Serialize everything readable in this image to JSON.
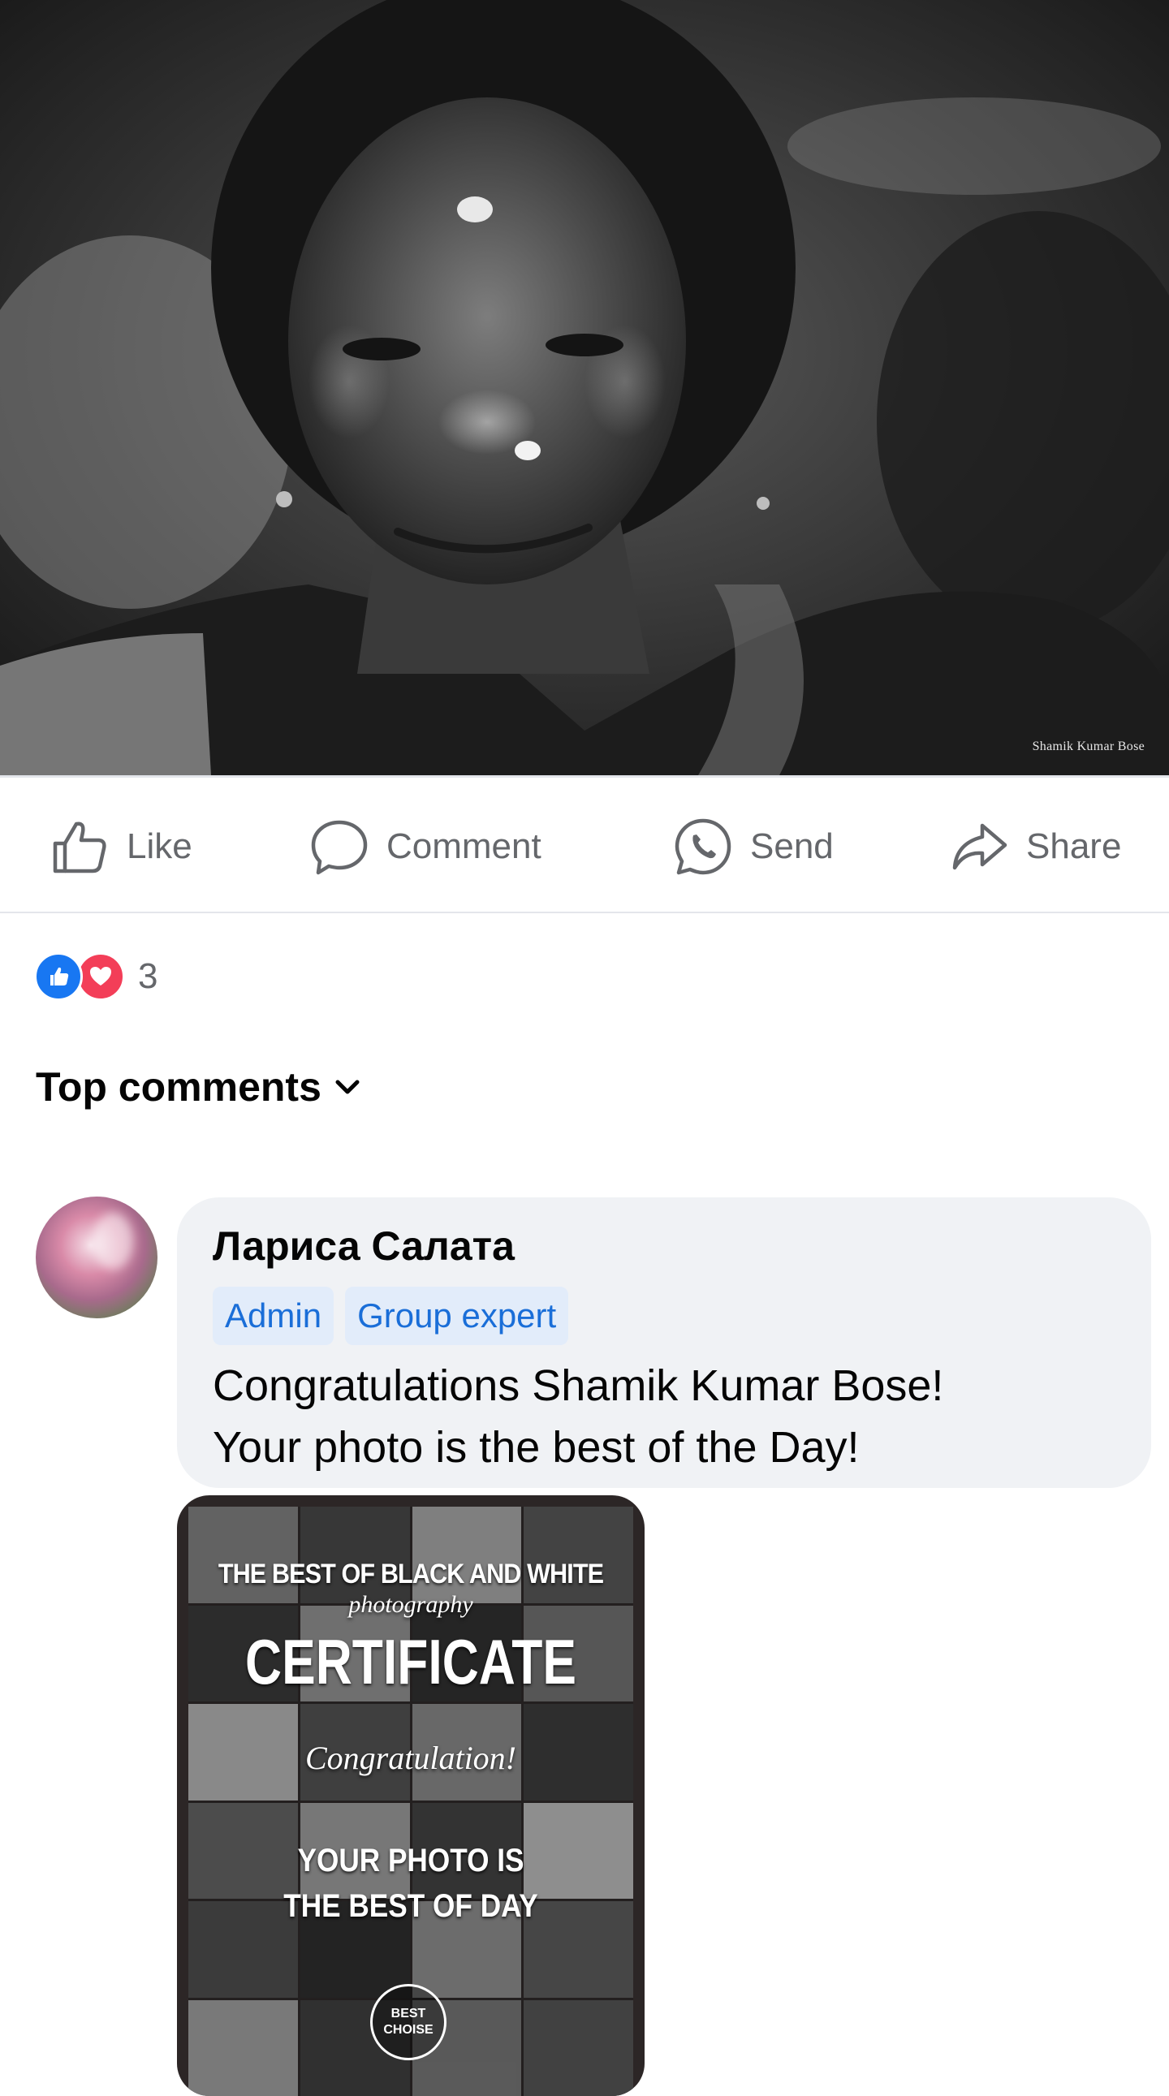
{
  "post": {
    "photo_alt": "",
    "watermark": "Shamik Kumar Bose"
  },
  "actions": {
    "like_label": "Like",
    "comment_label": "Comment",
    "send_label": "Send",
    "share_label": "Share"
  },
  "reactions": {
    "types": [
      "like-icon",
      "love-icon"
    ],
    "count": "3",
    "colors": {
      "like": "#1877f2",
      "love": "#f33e58"
    }
  },
  "comments_header": {
    "label": "Top comments",
    "icon": "chevron-down-icon"
  },
  "comment": {
    "author": "Лариса Салата",
    "badges": [
      "Admin",
      "Group expert"
    ],
    "text_line1": "Congratulations  Shamik Kumar Bose!",
    "text_line2": "Your photo is the best of the Day!",
    "attachment": {
      "line1": "THE BEST OF BLACK AND WHITE",
      "line2": "photography",
      "line3": "CERTIFICATE",
      "line4": "Congratulation!",
      "line5": "YOUR PHOTO IS",
      "line6": "THE BEST OF DAY",
      "seal_line1": "BEST",
      "seal_line2": "CHOISE"
    }
  },
  "theme": {
    "badge_bg": "#e2ecfa",
    "badge_text": "#1a6ed8",
    "bubble_bg": "#f0f2f5",
    "secondary_text": "#65676b"
  }
}
